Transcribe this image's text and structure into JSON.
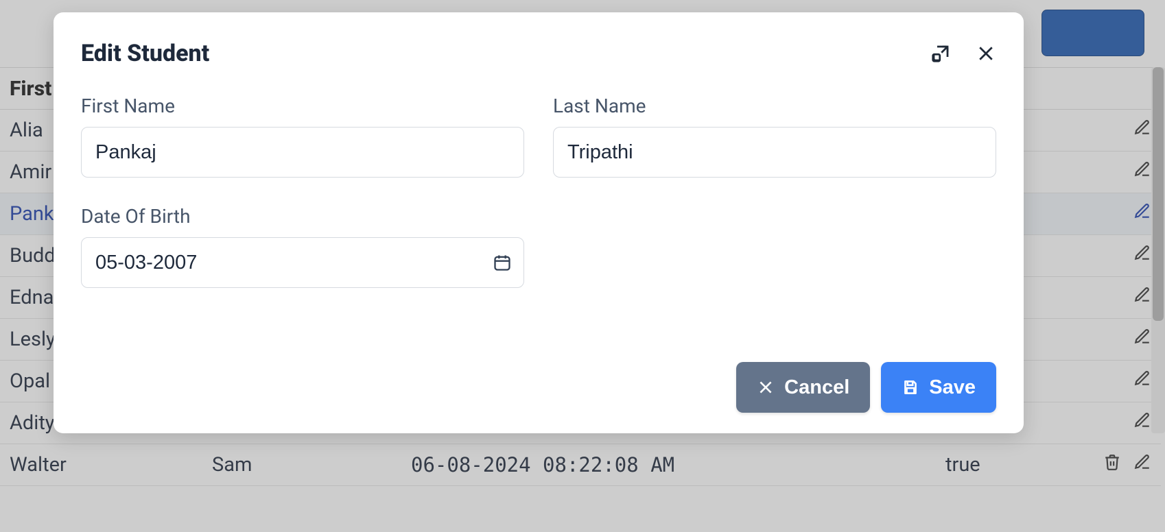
{
  "modal": {
    "title": "Edit Student",
    "first_name_label": "First Name",
    "first_name_value": "Pankaj",
    "last_name_label": "Last Name",
    "last_name_value": "Tripathi",
    "dob_label": "Date Of Birth",
    "dob_value": "05-03-2007",
    "cancel_label": "Cancel",
    "save_label": "Save"
  },
  "table": {
    "header_first": "First",
    "rows": [
      {
        "first": "Alia",
        "last": "",
        "ts": "",
        "bool": "",
        "selected": false
      },
      {
        "first": "Amir",
        "last": "",
        "ts": "",
        "bool": "",
        "selected": false
      },
      {
        "first": "Panka",
        "last": "",
        "ts": "",
        "bool": "",
        "selected": true
      },
      {
        "first": "Budd",
        "last": "",
        "ts": "",
        "bool": "",
        "selected": false
      },
      {
        "first": "Edna",
        "last": "",
        "ts": "",
        "bool": "",
        "selected": false
      },
      {
        "first": "Lesly",
        "last": "",
        "ts": "",
        "bool": "",
        "selected": false
      },
      {
        "first": "Opal",
        "last": "",
        "ts": "",
        "bool": "",
        "selected": false
      },
      {
        "first": "Adity",
        "last": "",
        "ts": "",
        "bool": "",
        "selected": false
      },
      {
        "first": "Walter",
        "last": "Sam",
        "ts": "06-08-2024 08:22:08 AM",
        "bool": "true",
        "selected": false
      }
    ]
  }
}
